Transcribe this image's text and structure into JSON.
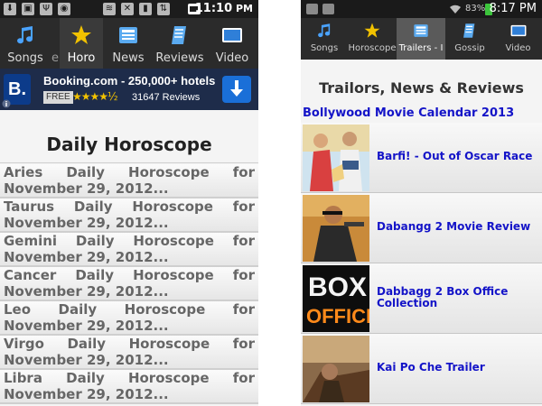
{
  "left_screen": {
    "status_bar": {
      "time": "11:10",
      "time_suffix": "PM"
    },
    "tabs": [
      {
        "label": "Songs",
        "icon": "music-note-icon",
        "active": false
      },
      {
        "label": "e",
        "icon": "",
        "active": false
      },
      {
        "label": "Horo",
        "icon": "star-icon",
        "active": true
      },
      {
        "label": "News",
        "icon": "news-icon",
        "active": false
      },
      {
        "label": "Reviews",
        "icon": "review-icon",
        "active": false
      },
      {
        "label": "Video",
        "icon": "video-icon",
        "active": false
      }
    ],
    "ad": {
      "logo_letter": "B.",
      "headline": "Booking.com - 250,000+ hotels",
      "badge": "FREE",
      "rating_stars": "★★★★½",
      "reviews": "31647 Reviews",
      "download_icon": "download-arrow-icon",
      "info_icon": "info-icon"
    },
    "heading": "Daily Horoscope",
    "items": [
      {
        "sign": "Aries",
        "w2": "Daily",
        "w3": "Horoscope",
        "w4": "for",
        "line2": "November 29, 2012..."
      },
      {
        "sign": "Taurus",
        "w2": "Daily",
        "w3": "Horoscope",
        "w4": "for",
        "line2": "November 29, 2012..."
      },
      {
        "sign": "Gemini",
        "w2": "Daily",
        "w3": "Horoscope",
        "w4": "for",
        "line2": "November 29, 2012..."
      },
      {
        "sign": "Cancer",
        "w2": "Daily",
        "w3": "Horoscope",
        "w4": "for",
        "line2": "November 29, 2012..."
      },
      {
        "sign": "Leo",
        "w2": "Daily",
        "w3": "Horoscope",
        "w4": "for",
        "line2": "November 29, 2012..."
      },
      {
        "sign": "Virgo",
        "w2": "Daily",
        "w3": "Horoscope",
        "w4": "for",
        "line2": "November 29, 2012..."
      },
      {
        "sign": "Libra",
        "w2": "Daily",
        "w3": "Horoscope",
        "w4": "for",
        "line2": "November 29, 2012..."
      }
    ]
  },
  "right_screen": {
    "status_bar": {
      "battery_pct": "83%",
      "time": "8:17 PM"
    },
    "tabs": [
      {
        "label": "Songs",
        "icon": "music-note-icon",
        "active": false
      },
      {
        "label": "Horoscope",
        "icon": "star-icon",
        "active": false
      },
      {
        "label": "Trailers - I",
        "icon": "news-icon",
        "active": true
      },
      {
        "label": "Gossip",
        "icon": "gossip-icon",
        "active": false
      },
      {
        "label": "Video",
        "icon": "video-icon",
        "active": false
      }
    ],
    "heading": "Trailors, News & Reviews",
    "calendar_link": "Bollywood Movie Calendar 2013",
    "items": [
      {
        "title": "Barfi! - Out of Oscar Race",
        "thumb": "barfi-thumbnail"
      },
      {
        "title": "Dabangg 2 Movie Review",
        "thumb": "dabangg-thumbnail"
      },
      {
        "title": "Dabbagg 2 Box Office Collection",
        "thumb": "box-office-thumbnail"
      },
      {
        "title": "Kai Po Che Trailer",
        "thumb": "kai-po-che-thumbnail"
      }
    ]
  },
  "colors": {
    "tab_bar": "#2b2b2b",
    "active_tab": "#3a3a3a",
    "link_blue": "#1414c8",
    "ad_background": "#1e2c4a",
    "ad_button": "#1a6fd8",
    "star_yellow": "#f2c200"
  }
}
